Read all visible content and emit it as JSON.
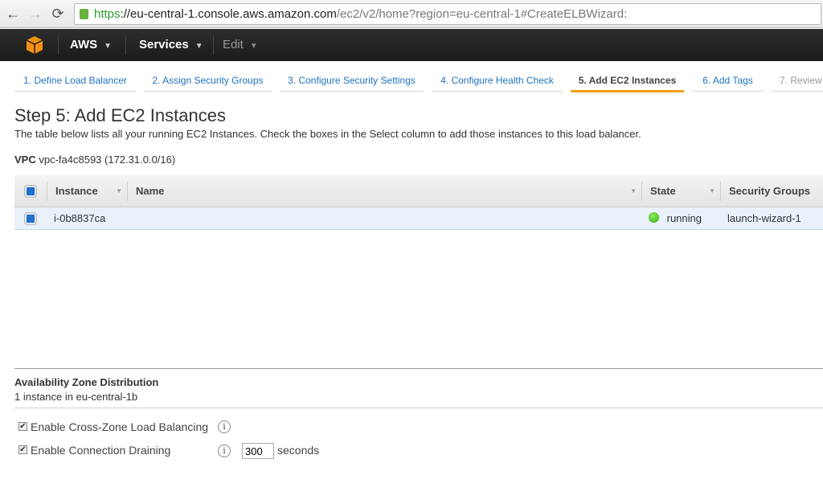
{
  "browser": {
    "url_scheme": "https",
    "url_host": "://eu-central-1.console.aws.amazon.com",
    "url_path": "/ec2/v2/home?region=eu-central-1#CreateELBWizard:"
  },
  "topnav": {
    "aws": "AWS",
    "services": "Services",
    "edit": "Edit",
    "logo_color": "#f29111"
  },
  "tabs": [
    {
      "label": "1. Define Load Balancer"
    },
    {
      "label": "2. Assign Security Groups"
    },
    {
      "label": "3. Configure Security Settings"
    },
    {
      "label": "4. Configure Health Check"
    },
    {
      "label": "5. Add EC2 Instances",
      "active": true
    },
    {
      "label": "6. Add Tags"
    },
    {
      "label": "7. Review"
    }
  ],
  "page": {
    "title": "Step 5: Add EC2 Instances",
    "description": "The table below lists all your running EC2 Instances. Check the boxes in the Select column to add those instances to this load balancer.",
    "vpc_label": "VPC",
    "vpc_value": "vpc-fa4c8593 (172.31.0.0/16)"
  },
  "table": {
    "headers": {
      "instance": "Instance",
      "name": "Name",
      "state": "State",
      "security_groups": "Security Groups"
    },
    "rows": [
      {
        "instance": "i-0b8837ca",
        "name": "",
        "state": "running",
        "security_groups": "launch-wizard-1",
        "selected": true
      }
    ]
  },
  "az": {
    "title": "Availability Zone Distribution",
    "text": "1 instance in eu-central-1b"
  },
  "options": {
    "cross_zone": {
      "label": "Enable Cross-Zone Load Balancing",
      "checked": true
    },
    "draining": {
      "label": "Enable Connection Draining",
      "checked": true,
      "value": "300",
      "unit": "seconds"
    }
  }
}
